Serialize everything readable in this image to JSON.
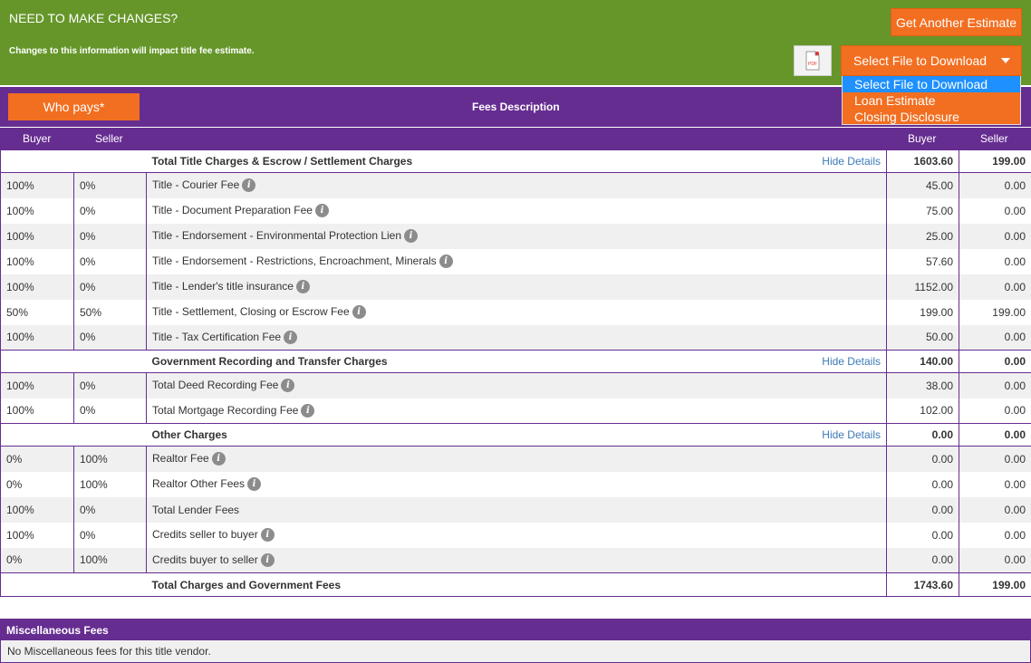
{
  "banner": {
    "title": "NEED TO MAKE CHANGES?",
    "subtitle": "Changes to this information will impact title fee estimate.",
    "estimate_button": "Get Another Estimate",
    "pdf_icon_text": "PDF",
    "select_label": "Select File to Download"
  },
  "dropdown": {
    "options": [
      "Select File to Download",
      "Loan Estimate",
      "Closing Disclosure"
    ],
    "selected_index": 0
  },
  "header": {
    "who_pays": "Who pays*",
    "fees_description": "Fees Description",
    "col_buyer_left": "Buyer",
    "col_seller_left": "Seller",
    "col_buyer_right": "Buyer",
    "col_seller_right": "Seller"
  },
  "sections": [
    {
      "title": "Total Title Charges & Escrow / Settlement Charges",
      "toggle": "Hide Details",
      "buyer_total": "1603.60",
      "seller_total": "199.00",
      "rows": [
        {
          "buyer_pct": "100%",
          "seller_pct": "0%",
          "desc": "Title - Courier Fee",
          "info": true,
          "buyer": "45.00",
          "seller": "0.00"
        },
        {
          "buyer_pct": "100%",
          "seller_pct": "0%",
          "desc": "Title - Document Preparation Fee",
          "info": true,
          "buyer": "75.00",
          "seller": "0.00"
        },
        {
          "buyer_pct": "100%",
          "seller_pct": "0%",
          "desc": "Title - Endorsement - Environmental Protection Lien",
          "info": true,
          "buyer": "25.00",
          "seller": "0.00"
        },
        {
          "buyer_pct": "100%",
          "seller_pct": "0%",
          "desc": "Title - Endorsement - Restrictions, Encroachment, Minerals",
          "info": true,
          "buyer": "57.60",
          "seller": "0.00"
        },
        {
          "buyer_pct": "100%",
          "seller_pct": "0%",
          "desc": "Title - Lender's title insurance",
          "info": true,
          "buyer": "1152.00",
          "seller": "0.00"
        },
        {
          "buyer_pct": "50%",
          "seller_pct": "50%",
          "desc": "Title - Settlement, Closing or Escrow Fee",
          "info": true,
          "buyer": "199.00",
          "seller": "199.00"
        },
        {
          "buyer_pct": "100%",
          "seller_pct": "0%",
          "desc": "Title - Tax Certification Fee",
          "info": true,
          "buyer": "50.00",
          "seller": "0.00"
        }
      ]
    },
    {
      "title": "Government Recording and Transfer Charges",
      "toggle": "Hide Details",
      "buyer_total": "140.00",
      "seller_total": "0.00",
      "rows": [
        {
          "buyer_pct": "100%",
          "seller_pct": "0%",
          "desc": "Total Deed Recording Fee",
          "info": true,
          "buyer": "38.00",
          "seller": "0.00"
        },
        {
          "buyer_pct": "100%",
          "seller_pct": "0%",
          "desc": "Total Mortgage Recording Fee",
          "info": true,
          "buyer": "102.00",
          "seller": "0.00"
        }
      ]
    },
    {
      "title": "Other Charges",
      "toggle": "Hide Details",
      "buyer_total": "0.00",
      "seller_total": "0.00",
      "rows": [
        {
          "buyer_pct": "0%",
          "seller_pct": "100%",
          "desc": "Realtor Fee",
          "info": true,
          "buyer": "0.00",
          "seller": "0.00"
        },
        {
          "buyer_pct": "0%",
          "seller_pct": "100%",
          "desc": "Realtor Other Fees",
          "info": true,
          "buyer": "0.00",
          "seller": "0.00"
        },
        {
          "buyer_pct": "100%",
          "seller_pct": "0%",
          "desc": "Total Lender Fees",
          "info": false,
          "buyer": "0.00",
          "seller": "0.00"
        },
        {
          "buyer_pct": "100%",
          "seller_pct": "0%",
          "desc": "Credits seller to buyer",
          "info": true,
          "buyer": "0.00",
          "seller": "0.00"
        },
        {
          "buyer_pct": "0%",
          "seller_pct": "100%",
          "desc": "Credits buyer to seller",
          "info": true,
          "buyer": "0.00",
          "seller": "0.00"
        }
      ]
    }
  ],
  "grand_total": {
    "label": "Total Charges and Government Fees",
    "buyer": "1743.60",
    "seller": "199.00"
  },
  "misc": {
    "title": "Miscellaneous Fees",
    "message": "No Miscellaneous fees for this title vendor."
  },
  "info_glyph": "i",
  "colors": {
    "green": "#66962a",
    "purple": "#662d91",
    "orange": "#f26f21",
    "link": "#3d7ab8",
    "highlight": "#1e90ff"
  }
}
